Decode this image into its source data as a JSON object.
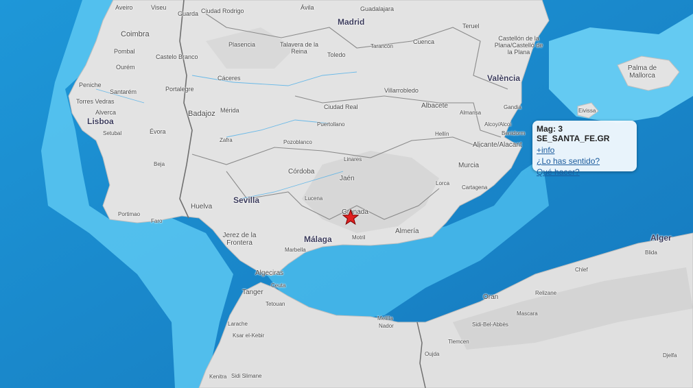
{
  "colors": {
    "ocean_deep": "#1886cc",
    "ocean_mid": "#27a5e3",
    "ocean_shelf": "#62ccf4",
    "land": "#e2e2e2",
    "land_shade": "#d0d0d0",
    "border": "#7a7a7a",
    "popup_bg": "#f0f8fd",
    "link": "#1a5a9c",
    "epicenter": "#e02020"
  },
  "popup": {
    "title": "Mag: 3 SE_SANTA_FE.GR",
    "link_info": "+info",
    "link_felt": "¿Lo has sentido?",
    "link_whattodo": "Qué hacer?"
  },
  "epicenter": {
    "icon": "star-icon",
    "location": "SE_SANTA_FE.GR"
  },
  "labels": {
    "madrid": "Madrid",
    "valencia": "València",
    "lisboa": "Lisboa",
    "sevilla": "Sevilla",
    "malaga": "Málaga",
    "alger": "Alger",
    "aveiro": "Aveiro",
    "viseu": "Viseu",
    "guarda": "Guarda",
    "ciudad_rodrigo": "Ciudad Rodrigo",
    "avila": "Ávila",
    "guadalajara": "Guadalajara",
    "coimbra": "Coimbra",
    "plasencia": "Plasencia",
    "talavera": "Talavera de la Reina",
    "toledo": "Toledo",
    "tarancon": "Tarancón",
    "cuenca": "Cuenca",
    "teruel": "Teruel",
    "castellon": "Castellón de la Plana/Castelló de la Plana",
    "pombal": "Pombal",
    "castelo_branco": "Castelo Branco",
    "ourem": "Ourém",
    "peniche": "Peniche",
    "santarem": "Santarém",
    "caceres": "Cáceres",
    "portalegre": "Portalegre",
    "torres_vedras": "Torres Vedras",
    "villarrobledo": "Villarrobledo",
    "palma": "Palma de Mallorca",
    "alverca": "Alverca",
    "badajoz": "Badajoz",
    "merida": "Mérida",
    "ciudad_real": "Ciudad Real",
    "albacete": "Albacete",
    "almansa": "Almansa",
    "gandia": "Gandia",
    "eivissa": "Eivissa",
    "setubal": "Setubal",
    "evora": "Évora",
    "puertollano": "Puertollano",
    "alcoy": "Alcoy/Alcoi",
    "hellin": "Hellín",
    "benidorm": "Benidorm",
    "zafra": "Zafra",
    "pozoblanco": "Pozoblanco",
    "alicante": "Alicante/Alacant",
    "beja": "Beja",
    "linares": "Linares",
    "cordoba": "Córdoba",
    "murcia": "Murcia",
    "jaen": "Jaén",
    "lorca": "Lorca",
    "cartagena": "Cartagena",
    "lucena": "Lucena",
    "huelva": "Huelva",
    "portimao": "Portimao",
    "faro": "Faro",
    "granada": "Granada",
    "jerez": "Jerez de la Frontera",
    "motril": "Motril",
    "almeria": "Almería",
    "marbella": "Marbella",
    "blida": "Blida",
    "algeciras": "Algeciras",
    "chlef": "Chlef",
    "ceuta": "Ceuta",
    "tanger": "Tanger",
    "relizane": "Relizane",
    "tetouan": "Tetouan",
    "oran": "Oran",
    "mascara": "Mascara",
    "larache": "Larache",
    "melilla": "Melilla",
    "nador": "Nador",
    "sidi_bel_abbes": "Sidi-Bel-Abbès",
    "ksar": "Ksar el-Kebir",
    "tlemcen": "Tlemcen",
    "oujda": "Oujda",
    "djelfa": "Djelfa",
    "kenitra": "Kenitra",
    "sidi_slimane": "Sidi Slimane"
  }
}
